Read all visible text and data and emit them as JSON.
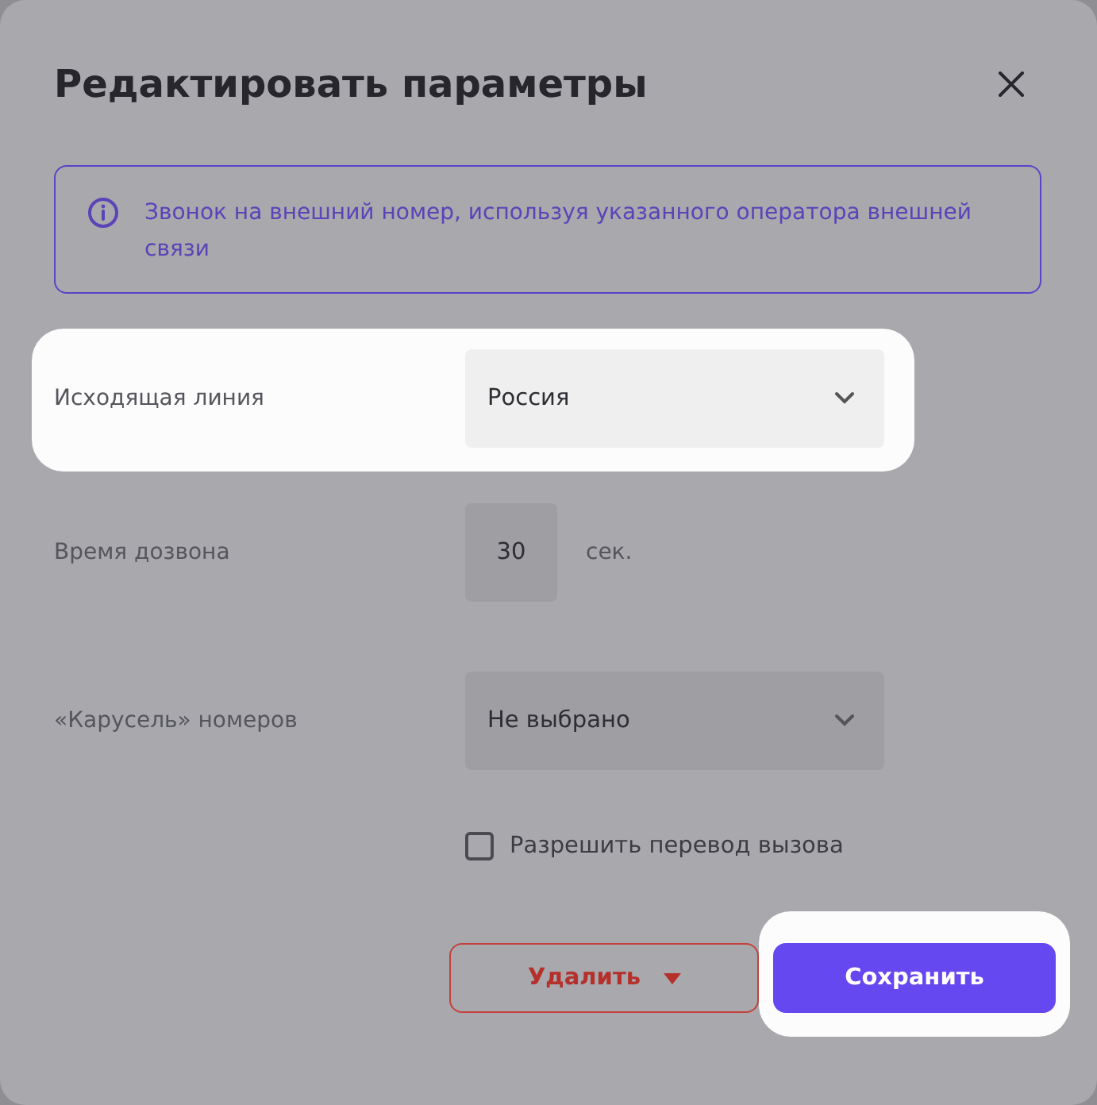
{
  "dialog": {
    "title": "Редактировать параметры"
  },
  "info": {
    "text": "Звонок на внешний номер, используя указанного оператора внешней связи"
  },
  "fields": [
    {
      "kind": "select",
      "label": "Исходящая линия",
      "value": "Россия",
      "highlighted": true
    },
    {
      "kind": "number",
      "label": "Время дозвона",
      "value": "30",
      "unit": "сек.",
      "highlighted": false
    },
    {
      "kind": "select",
      "label": "«Карусель» номеров",
      "value": "Не выбрано",
      "highlighted": false
    }
  ],
  "checkbox": {
    "label": "Разрешить перевод вызова",
    "checked": false
  },
  "buttons": [
    {
      "kind": "danger",
      "label": "Удалить",
      "highlighted": false
    },
    {
      "kind": "primary",
      "label": "Сохранить",
      "highlighted": true
    }
  ]
}
